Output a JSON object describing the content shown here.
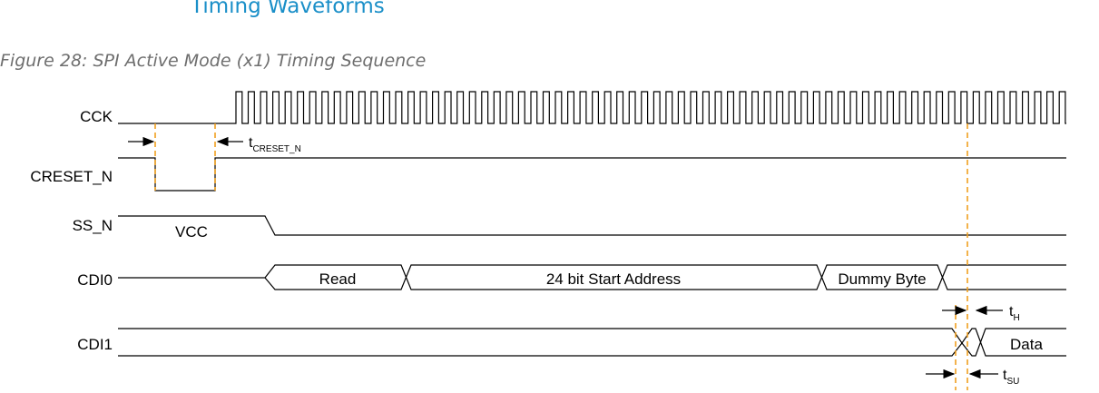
{
  "header": {
    "section_title": "Timing Waveforms",
    "figure_caption": "Figure 28: SPI Active Mode (x1) Timing Sequence"
  },
  "signals": {
    "cck": "CCK",
    "creset_n": "CRESET_N",
    "ss_n": "SS_N",
    "cdi0": "CDI0",
    "cdi1": "CDI1"
  },
  "bus_fields": {
    "vcc": "VCC",
    "read": "Read",
    "address": "24 bit Start Address",
    "dummy": "Dummy Byte",
    "data": "Data"
  },
  "timing_params": {
    "creset": {
      "main": "t",
      "sub": "CRESET_N"
    },
    "hold": {
      "main": "t",
      "sub": "H"
    },
    "setup": {
      "main": "t",
      "sub": "SU"
    }
  },
  "colors": {
    "section_title": "#1a8fc8",
    "caption": "#6e6e6e",
    "marker": "#f0a020",
    "wave": "#000000"
  }
}
